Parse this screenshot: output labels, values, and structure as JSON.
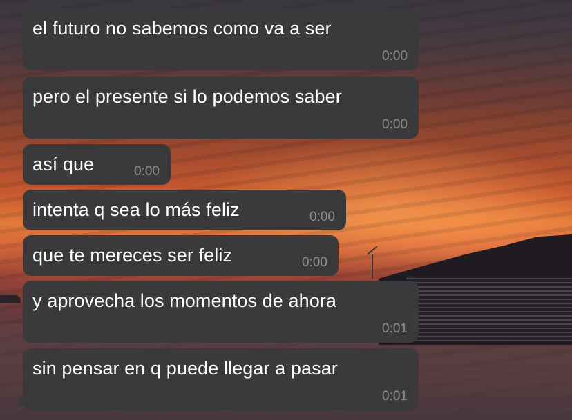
{
  "messages": [
    {
      "text": "el futuro no sabemos como va a ser",
      "time": "0:00"
    },
    {
      "text": "pero el presente si lo podemos saber",
      "time": "0:00"
    },
    {
      "text": "así que",
      "time": "0:00"
    },
    {
      "text": "intenta q sea lo más feliz",
      "time": "0:00"
    },
    {
      "text": "que te mereces ser feliz",
      "time": "0:00"
    },
    {
      "text": "y aprovecha los momentos de ahora",
      "time": "0:01"
    },
    {
      "text": "sin pensar en q puede llegar a pasar",
      "time": "0:01"
    }
  ],
  "colors": {
    "bubble_background": "#3a3a3c",
    "message_text": "#ffffff",
    "timestamp_text": "#8e8e93"
  },
  "background": {
    "description_icon": "sunset-wallpaper"
  }
}
